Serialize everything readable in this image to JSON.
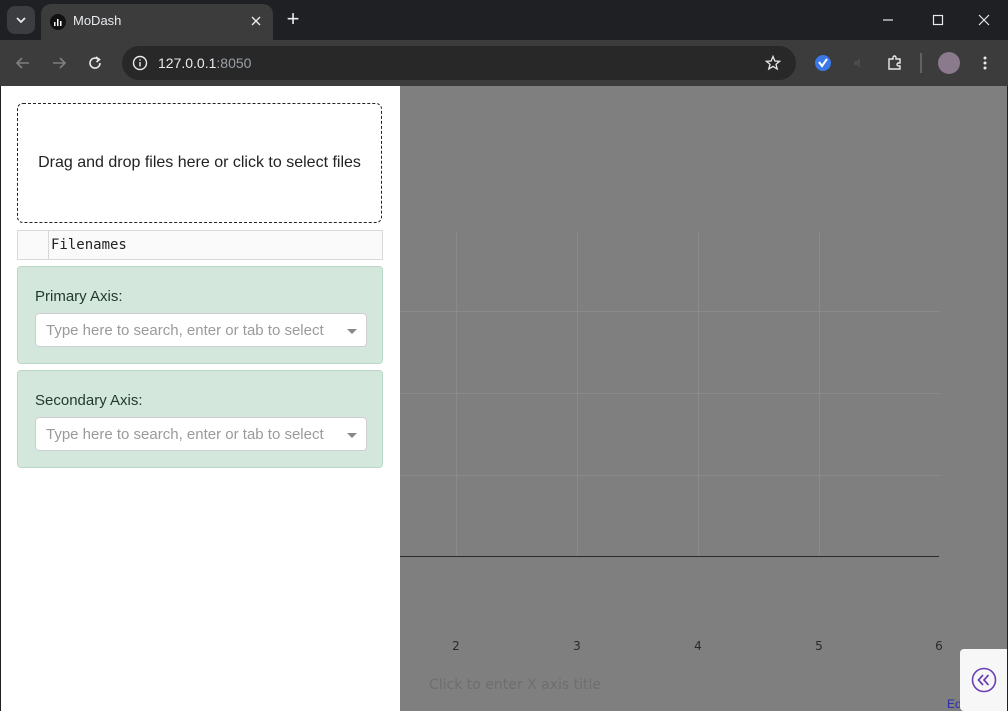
{
  "browser": {
    "tab_title": "MoDash",
    "new_tab_symbol": "+",
    "url_host": "127.0.0.1",
    "url_port": ":8050"
  },
  "sidebar": {
    "upload_text": "Drag and drop files here or click to select files",
    "filenames_header": "Filenames",
    "primary_axis": {
      "label": "Primary Axis:",
      "placeholder": "Type here to search, enter or tab to select"
    },
    "secondary_axis": {
      "label": "Secondary Axis:",
      "placeholder": "Type here to search, enter or tab to select"
    }
  },
  "graph": {
    "x_ticks": [
      "2",
      "3",
      "4",
      "5",
      "6"
    ],
    "x_axis_title_placeholder": "Click to enter X axis title",
    "edit_link": "Ed"
  },
  "colors": {
    "overlay": "#7f7f7f",
    "axis_card": "#d4e7dc",
    "collapse_icon": "#6a3fb5"
  },
  "icons": {
    "tab_menu": "chevron-down-icon",
    "favicon": "bar-chart-icon",
    "close": "close-icon",
    "back": "back-arrow-icon",
    "forward": "forward-arrow-icon",
    "reload": "reload-icon",
    "site_info": "info-icon",
    "bookmark": "star-icon",
    "extensions": "puzzle-icon",
    "menu": "kebab-menu-icon",
    "collapse": "double-chevron-left-icon"
  }
}
